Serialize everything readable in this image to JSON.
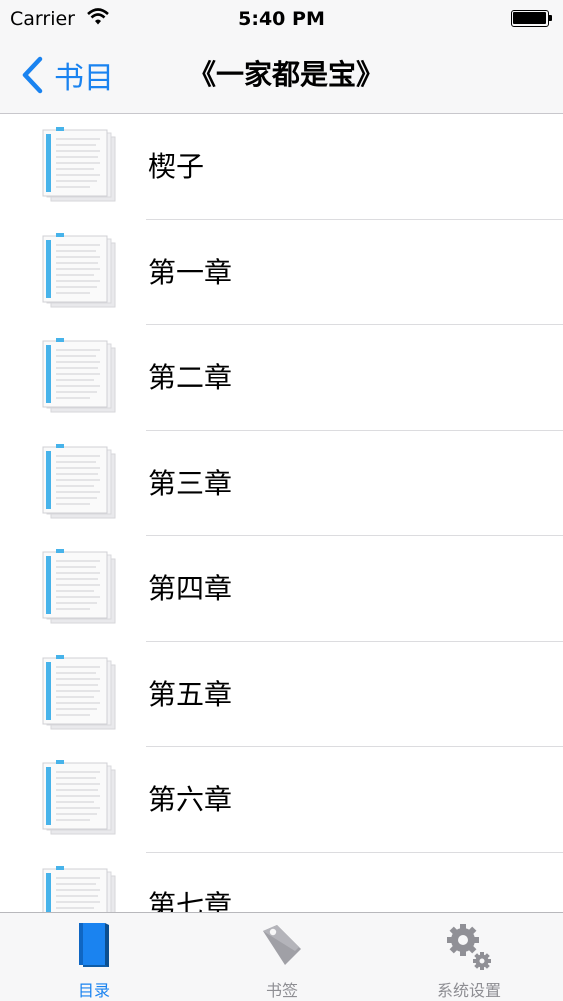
{
  "status_bar": {
    "carrier": "Carrier",
    "time": "5:40 PM"
  },
  "nav_bar": {
    "back_label": "书目",
    "title": "《一家都是宝》"
  },
  "chapters": [
    "楔子",
    "第一章",
    "第二章",
    "第三章",
    "第四章",
    "第五章",
    "第六章",
    "第七章"
  ],
  "tab_bar": {
    "items": [
      {
        "label": "目录",
        "icon": "book-icon",
        "active": true
      },
      {
        "label": "书签",
        "icon": "tag-icon",
        "active": false
      },
      {
        "label": "系统设置",
        "icon": "gears-icon",
        "active": false
      }
    ]
  },
  "colors": {
    "accent": "#1a83f0",
    "inactive": "#8e8e93"
  }
}
